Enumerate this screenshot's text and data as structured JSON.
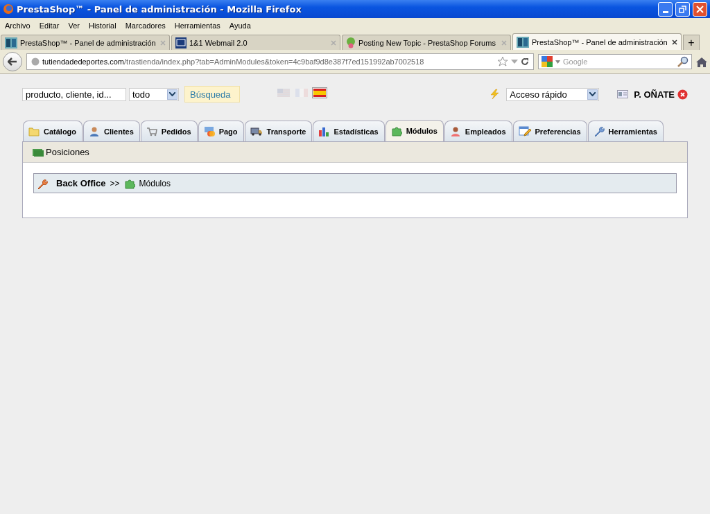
{
  "window": {
    "title": "PrestaShop™ - Panel de administración - Mozilla Firefox"
  },
  "menu": [
    {
      "label": "Archivo"
    },
    {
      "label": "Editar"
    },
    {
      "label": "Ver"
    },
    {
      "label": "Historial"
    },
    {
      "label": "Marcadores"
    },
    {
      "label": "Herramientas"
    },
    {
      "label": "Ayuda"
    }
  ],
  "browser_tabs": [
    {
      "title": "PrestaShop™ - Panel de administración",
      "kind": "ps",
      "selected": false
    },
    {
      "title": "1&1 Webmail 2.0",
      "kind": "webmail",
      "selected": false
    },
    {
      "title": "Posting New Topic - PrestaShop Forums",
      "kind": "forum",
      "selected": false
    },
    {
      "title": "PrestaShop™ - Panel de administración",
      "kind": "ps",
      "selected": true
    }
  ],
  "new_tab": "+",
  "address": {
    "host": "tutiendadedeportes.com",
    "path": "/trastienda/index.php?tab=AdminModules&token=4c9baf9d8e387f7ed151992ab7002518"
  },
  "web_search": {
    "placeholder": "Google"
  },
  "admin_header": {
    "search_value": "producto, cliente, id...",
    "search_scope": "todo",
    "search_button": "Búsqueda",
    "languages": [
      {
        "kind": "en",
        "selected": false
      },
      {
        "kind": "fr",
        "selected": false
      },
      {
        "kind": "es",
        "selected": true
      }
    ],
    "quick_access": "Acceso rápido",
    "user": "P. OÑATE"
  },
  "admin_tabs": [
    {
      "label": "Catálogo",
      "kind": "folder",
      "selected": false
    },
    {
      "label": "Clientes",
      "kind": "person",
      "selected": false
    },
    {
      "label": "Pedidos",
      "kind": "cart",
      "selected": false
    },
    {
      "label": "Pago",
      "kind": "card",
      "selected": false
    },
    {
      "label": "Transporte",
      "kind": "truck",
      "selected": false
    },
    {
      "label": "Estadísticas",
      "kind": "chart",
      "selected": false
    },
    {
      "label": "Módulos",
      "kind": "puzzle",
      "selected": true
    },
    {
      "label": "Empleados",
      "kind": "employee",
      "selected": false
    },
    {
      "label": "Preferencias",
      "kind": "pencil",
      "selected": false
    },
    {
      "label": "Herramientas",
      "kind": "wrench",
      "selected": false
    }
  ],
  "subtabs": [
    {
      "label": "Posiciones"
    }
  ],
  "breadcrumb": {
    "root": "Back Office",
    "separator": ">>",
    "current": "Módulos"
  }
}
